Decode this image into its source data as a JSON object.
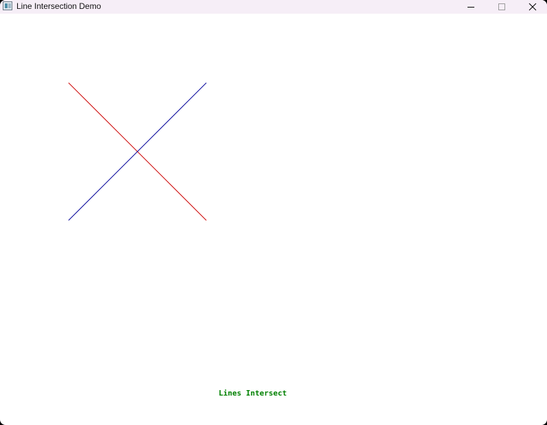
{
  "window": {
    "title": "Line Intersection Demo",
    "controls": {
      "minimize": "minimize-icon",
      "maximize": "maximize-icon",
      "close": "close-icon"
    }
  },
  "lines": [
    {
      "name": "red",
      "color": "#cc0000"
    },
    {
      "name": "blue",
      "color": "#000099"
    }
  ],
  "status": {
    "text": "Lines Intersect",
    "color": "#008000"
  }
}
